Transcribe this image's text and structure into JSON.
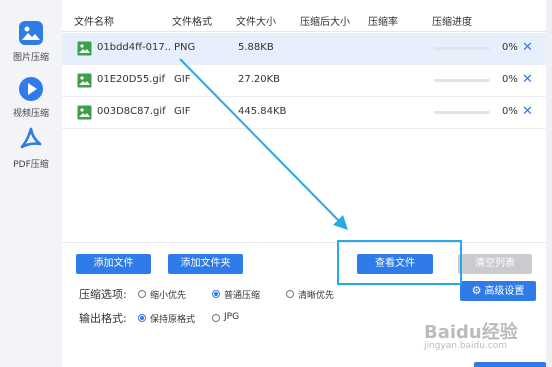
{
  "sidebar": {
    "items": [
      {
        "label": "图片压缩",
        "icon": "image-compress-icon",
        "color": "#2f7be8"
      },
      {
        "label": "视频压缩",
        "icon": "video-play-icon",
        "color": "#2f7be8"
      },
      {
        "label": "PDF压缩",
        "icon": "pdf-icon",
        "color": "#2f7be8"
      }
    ]
  },
  "table": {
    "headers": [
      "文件名称",
      "文件格式",
      "文件大小",
      "压缩后大小",
      "压缩率",
      "压缩进度"
    ],
    "rows": [
      {
        "name": "01bdd4ff-017..",
        "format": "PNG",
        "size": "5.88KB",
        "after": "",
        "ratio": "",
        "progress": "0%",
        "progress_value": 0,
        "selected": true
      },
      {
        "name": "01E20D55.gif",
        "format": "GIF",
        "size": "27.20KB",
        "after": "",
        "ratio": "",
        "progress": "0%",
        "progress_value": 0,
        "selected": false
      },
      {
        "name": "003D8C87.gif",
        "format": "GIF",
        "size": "445.84KB",
        "after": "",
        "ratio": "",
        "progress": "0%",
        "progress_value": 0,
        "selected": false
      }
    ]
  },
  "buttons": {
    "add_file": "添加文件",
    "add_folder": "添加文件夹",
    "view_file": "查看文件",
    "clear_list": "清空列表",
    "advanced": "高级设置"
  },
  "options": {
    "compress_label": "压缩选项:",
    "compress_choices": [
      "缩小优先",
      "普通压缩",
      "清晰优先"
    ],
    "compress_selected": "普通压缩",
    "output_label": "输出格式:",
    "output_choices": [
      "保持原格式",
      "JPG"
    ],
    "output_selected": "保持原格式"
  },
  "watermark": {
    "text": "Baidu经验",
    "sub": "jingyan.baidu.com"
  },
  "colors": {
    "accent": "#2f7be8",
    "annotation": "#2aa8e8",
    "selected_row": "#e6effb"
  }
}
